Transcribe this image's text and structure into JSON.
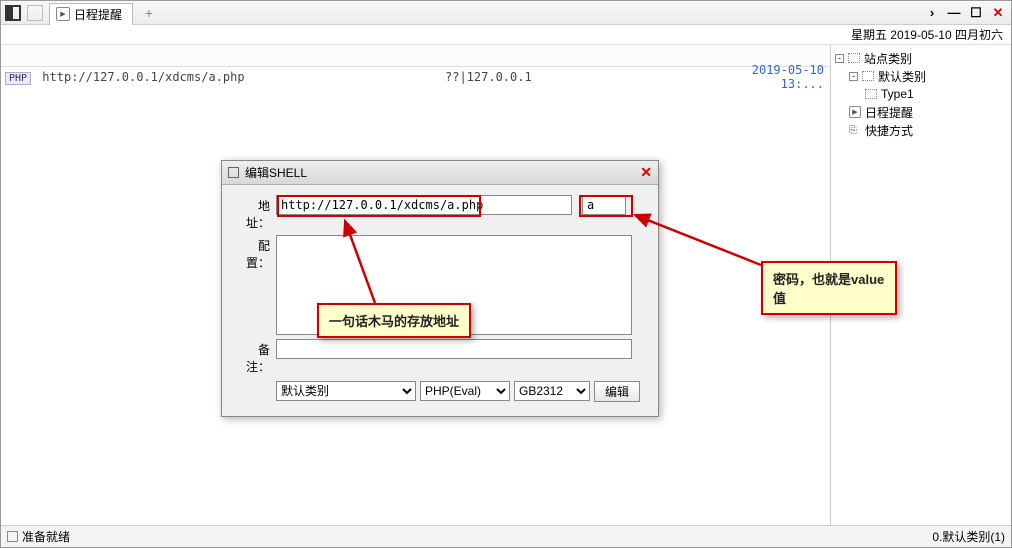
{
  "titlebar": {
    "tab_label": "日程提醒"
  },
  "datebar": {
    "text": "星期五 2019-05-10 四月初六"
  },
  "list": {
    "row": {
      "url": "http://127.0.0.1/xdcms/a.php",
      "ip": "??|127.0.0.1",
      "time": "2019-05-10 13:..."
    }
  },
  "sidebar": {
    "root": "站点类别",
    "default_cat": "默认类别",
    "type1": "Type1",
    "schedule": "日程提醒",
    "shortcut": "快捷方式"
  },
  "dialog": {
    "title": "编辑SHELL",
    "label_addr": "地址：",
    "label_config": "配置：",
    "label_remark": "备注：",
    "addr_value": "http://127.0.0.1/xdcms/a.php",
    "pass_value": "a",
    "sel_cat": "默认类别",
    "sel_type": "PHP(Eval)",
    "sel_charset": "GB2312",
    "btn_edit": "编辑"
  },
  "annotations": {
    "addr": "一句话木马的存放地址",
    "pass": "密码，也就是value值"
  },
  "status": {
    "ready": "准备就绪",
    "right": "0.默认类别(1)"
  }
}
